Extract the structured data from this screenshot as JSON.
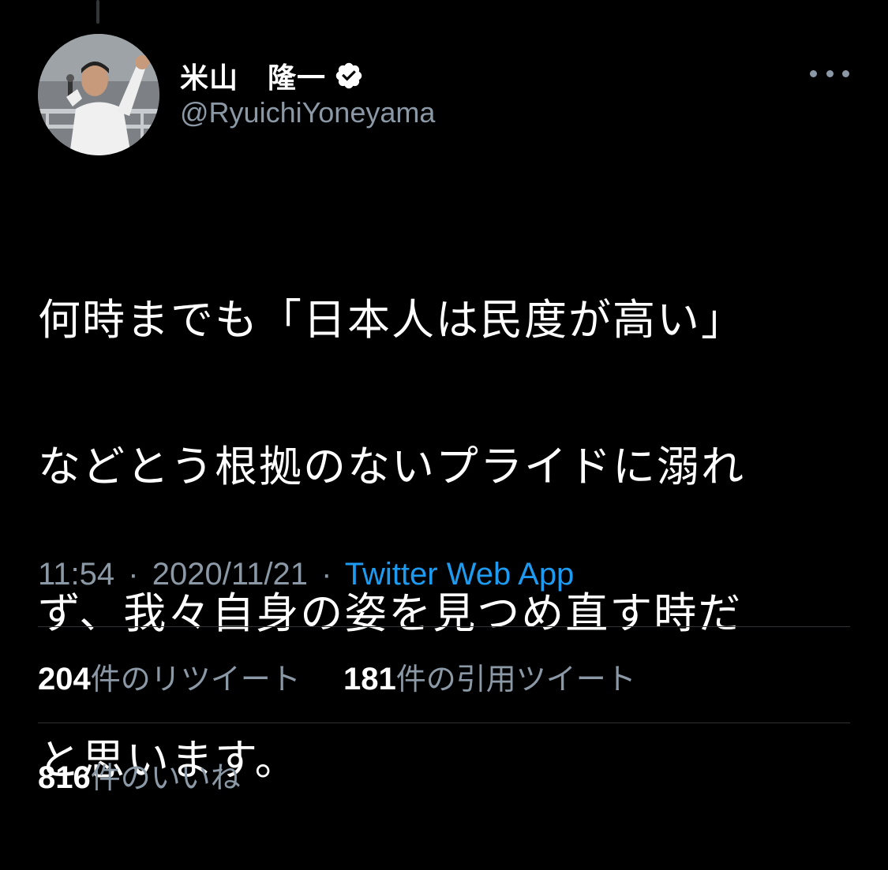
{
  "author": {
    "display_name": "米山　隆一",
    "handle": "@RyuichiYoneyama",
    "verified": true
  },
  "icons": {
    "verified": "verified-badge-icon",
    "more": "more-options-icon"
  },
  "tweet": {
    "lines": [
      "何時までも「日本人は民度が高い」",
      "などとう根拠のないプライドに溺れ",
      "ず、我々自身の姿を見つめ直す時だ",
      "と思います。"
    ]
  },
  "meta": {
    "time": "11:54",
    "date": "2020/11/21",
    "separator": "·",
    "source": "Twitter Web App"
  },
  "stats": {
    "retweets_count": "204",
    "retweets_label": "件のリツイート",
    "quotes_count": "181",
    "quotes_label": "件の引用ツイート",
    "likes_count": "816",
    "likes_label": "件のいいね"
  },
  "colors": {
    "background": "#000000",
    "text": "#ffffff",
    "secondary": "#8b98a5",
    "link": "#1d9bf0",
    "divider": "#2f3336"
  }
}
